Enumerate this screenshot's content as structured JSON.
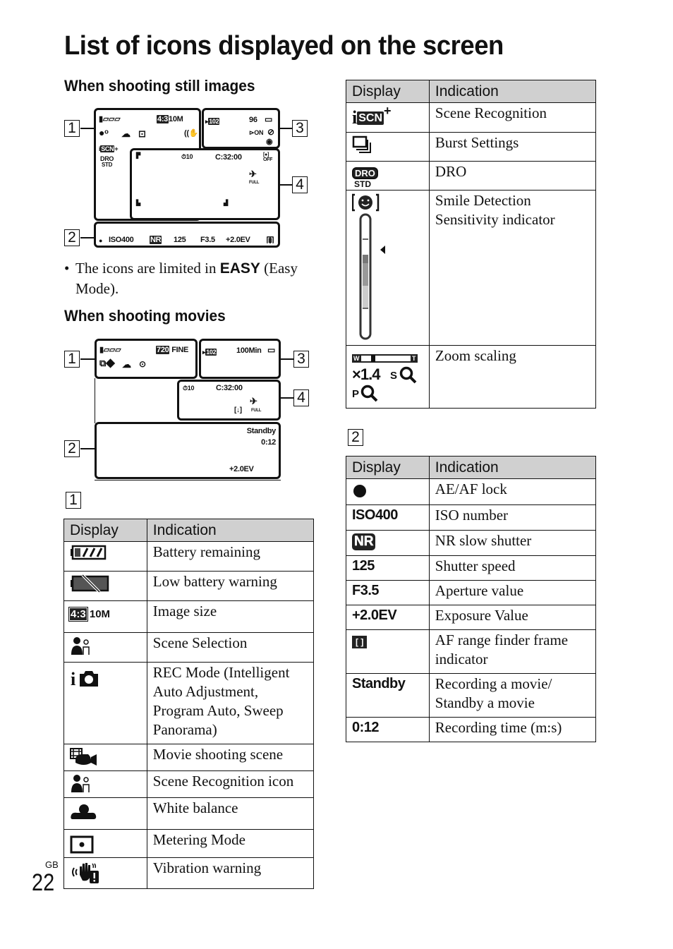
{
  "page": {
    "title": "List of icons displayed on the screen",
    "locale_label": "GB",
    "page_number": "22"
  },
  "still_section": {
    "heading": "When shooting still images",
    "callouts": [
      "1",
      "2",
      "3",
      "4"
    ],
    "screen": {
      "panel1": {
        "battery": "battery-icon",
        "aspect": "4:3",
        "size": "10M",
        "scn": "SCN",
        "dro_top": "DRO",
        "dro_bottom": "STD"
      },
      "panel3": {
        "folder": "102",
        "shots": "96",
        "smile": "ON"
      },
      "panel4": {
        "timer": "10",
        "counter": "C:32:00",
        "face": "OFF",
        "flash_level": "FULL"
      },
      "panel2": {
        "iso": "ISO400",
        "nr": "NR",
        "shutter": "125",
        "aperture": "F3.5",
        "ev": "+2.0EV",
        "af": "[ ]"
      }
    }
  },
  "note": {
    "bullet": "•",
    "before": "The icons are limited in ",
    "easy": "EASY",
    "after": " (Easy Mode)."
  },
  "movie_section": {
    "heading": "When shooting movies",
    "callouts": [
      "1",
      "2",
      "3",
      "4"
    ],
    "screen": {
      "panel1": {
        "quality_box": "720",
        "quality": "FINE"
      },
      "panel3": {
        "folder": "102",
        "remaining": "100Min"
      },
      "panel4": {
        "timer": "10",
        "counter": "C:32:00",
        "flash_level": "FULL"
      },
      "panel2": {
        "status": "Standby",
        "time": "0:12",
        "ev": "+2.0EV"
      }
    }
  },
  "table1": {
    "section_label": "1",
    "headers": [
      "Display",
      "Indication"
    ],
    "rows": [
      {
        "icon": "battery-remaining-icon",
        "indication": "Battery remaining"
      },
      {
        "icon": "low-battery-icon",
        "indication": "Low battery warning"
      },
      {
        "icon": "image-size-icon",
        "display_a": "4:3",
        "display_b": "10M",
        "indication": "Image size"
      },
      {
        "icon": "scene-selection-icon",
        "indication": "Scene Selection"
      },
      {
        "icon": "rec-mode-icon",
        "indication": "REC Mode (Intelligent Auto Adjustment, Program Auto, Sweep Panorama)"
      },
      {
        "icon": "movie-scene-icon",
        "indication": "Movie shooting scene"
      },
      {
        "icon": "scene-recognition-icon",
        "indication": "Scene Recognition icon"
      },
      {
        "icon": "white-balance-icon",
        "indication": "White balance"
      },
      {
        "icon": "metering-mode-icon",
        "indication": "Metering Mode"
      },
      {
        "icon": "vibration-warning-icon",
        "indication": "Vibration warning"
      }
    ]
  },
  "table1_cont": {
    "headers": [
      "Display",
      "Indication"
    ],
    "rows": [
      {
        "icon": "scene-recognition-scn-icon",
        "display": "SCN",
        "indication": "Scene Recognition"
      },
      {
        "icon": "burst-settings-icon",
        "indication": "Burst Settings"
      },
      {
        "icon": "dro-icon",
        "display_a": "DRO",
        "display_b": "STD",
        "indication": "DRO"
      },
      {
        "icon": "smile-detection-icon",
        "indication": "Smile Detection Sensitivity indicator"
      },
      {
        "icon": "zoom-scaling-icon",
        "display_a": "W",
        "display_b": "T",
        "display_c": "×1.4",
        "display_d": "S",
        "display_e": "P",
        "indication": "Zoom scaling"
      }
    ]
  },
  "table2": {
    "section_label": "2",
    "headers": [
      "Display",
      "Indication"
    ],
    "rows": [
      {
        "icon": "ae-af-lock-icon",
        "display": "",
        "indication": "AE/AF lock"
      },
      {
        "display": "ISO400",
        "indication": "ISO number"
      },
      {
        "icon": "nr-icon",
        "display": "NR",
        "indication": "NR slow shutter"
      },
      {
        "display": "125",
        "indication": "Shutter speed"
      },
      {
        "display": "F3.5",
        "indication": "Aperture value"
      },
      {
        "display": "+2.0EV",
        "indication": "Exposure Value"
      },
      {
        "icon": "af-range-finder-icon",
        "display": "[ ]",
        "indication": "AF range finder frame indicator"
      },
      {
        "display": "Standby",
        "indication": "Recording a movie/ Standby a movie"
      },
      {
        "display": "0:12",
        "indication": "Recording time (m:s)"
      }
    ]
  }
}
